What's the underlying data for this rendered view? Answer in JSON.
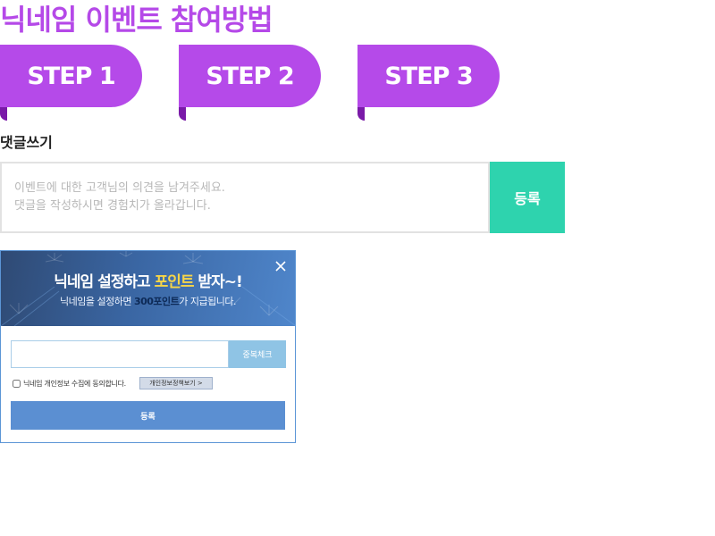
{
  "page": {
    "title": "닉네임 이벤트 참여방법"
  },
  "steps": [
    {
      "label": "STEP 1"
    },
    {
      "label": "STEP 2"
    },
    {
      "label": "STEP 3"
    }
  ],
  "comment": {
    "label": "댓글쓰기",
    "placeholder": "이벤트에 대한 고객님의 의견을 남겨주세요.\n댓글을 작성하시면 경험치가 올라갑니다.",
    "value": "",
    "submit_label": "등록"
  },
  "popup": {
    "title_before": "닉네임 설정하고 ",
    "title_highlight": "포인트",
    "title_after": " 받자~!",
    "sub_before": "닉네임을 설정하면 ",
    "sub_points": "300포인트",
    "sub_after": "가 지급됩니다.",
    "close_icon": "close-icon",
    "nickname_value": "",
    "check_label": "중복체크",
    "agree_label": "닉네임 개인정보 수집에 동의합니다.",
    "agree_checked": false,
    "policy_label": "개인정보정책보기 >",
    "submit_label": "등록"
  },
  "colors": {
    "accent_purple": "#b54ae9",
    "fold_purple": "#7a1aa8",
    "submit_green": "#2ed3ae",
    "popup_blue": "#5b8fd2",
    "highlight_yellow": "#f6d548"
  }
}
